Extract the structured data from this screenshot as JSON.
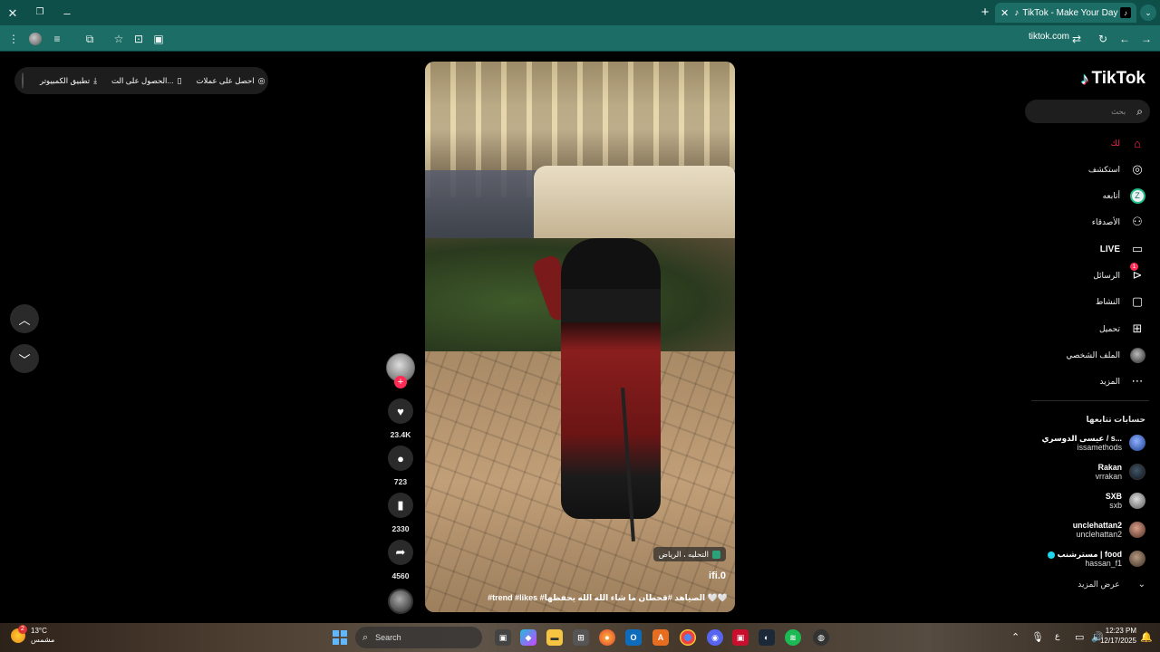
{
  "browser": {
    "tab_title": "TikTok - Make Your Day",
    "url": "tiktok.com",
    "tab_close_glyph": "✕",
    "new_tab_glyph": "+",
    "window_close_glyph": "✕",
    "window_restore_glyph": "❐",
    "window_minimize_glyph": "–"
  },
  "top_bar": {
    "get_coins": "احصل على عملات",
    "get_app": "الحصول على الت...",
    "desktop_app": "تطبيق الكمبيوتر"
  },
  "video": {
    "location": "التحليه ، الرياض",
    "author": "ifi.0",
    "caption": "#trend #likes #الصياهد #قحطان ما شاء الله الله يحفظها 🤍🤍"
  },
  "actions": {
    "likes": "23.4K",
    "comments": "723",
    "saves": "2330",
    "shares": "4560"
  },
  "sidebar": {
    "logo": "TikTok",
    "search_placeholder": "بحث",
    "menu": [
      {
        "label": "لك",
        "icon": "home-icon"
      },
      {
        "label": "استكشف",
        "icon": "compass-icon"
      },
      {
        "label": "أتابعه",
        "icon": "following-icon"
      },
      {
        "label": "الأصدقاء",
        "icon": "friends-icon"
      },
      {
        "label": "LIVE",
        "icon": "live-icon"
      },
      {
        "label": "الرسائل",
        "icon": "messages-icon",
        "badge": "1"
      },
      {
        "label": "النشاط",
        "icon": "activity-icon"
      },
      {
        "label": "تحميل",
        "icon": "upload-icon"
      },
      {
        "label": "الملف الشخصي",
        "icon": "profile-icon"
      },
      {
        "label": "المزيد",
        "icon": "more-icon"
      }
    ],
    "following_title": "حسابات تتابعها",
    "accounts": [
      {
        "name": "عيسى الدوسري / s...",
        "user": "issamethods",
        "color": "#3b6fd8"
      },
      {
        "name": "Rakan",
        "user": "vrrakan",
        "color": "#223344"
      },
      {
        "name": "SXB",
        "user": "sxb",
        "color": "#777777"
      },
      {
        "name": "unclehattan2",
        "user": "unclehattan2",
        "color": "#8a5a4a"
      },
      {
        "name": "مسترشنب | food",
        "user": "hassan_f1",
        "color": "#6b5a4a"
      }
    ],
    "see_more": "عرض المزيد"
  },
  "taskbar": {
    "temperature": "13°C",
    "weather_desc": "مشمس",
    "weather_badge": "2",
    "search": "Search",
    "time": "12:23 PM",
    "date": "12/17/2025"
  },
  "colors": {
    "accent": "#fe2c55",
    "chrome_title": "#0f4f4a",
    "chrome_toolbar": "#1c6d65"
  }
}
